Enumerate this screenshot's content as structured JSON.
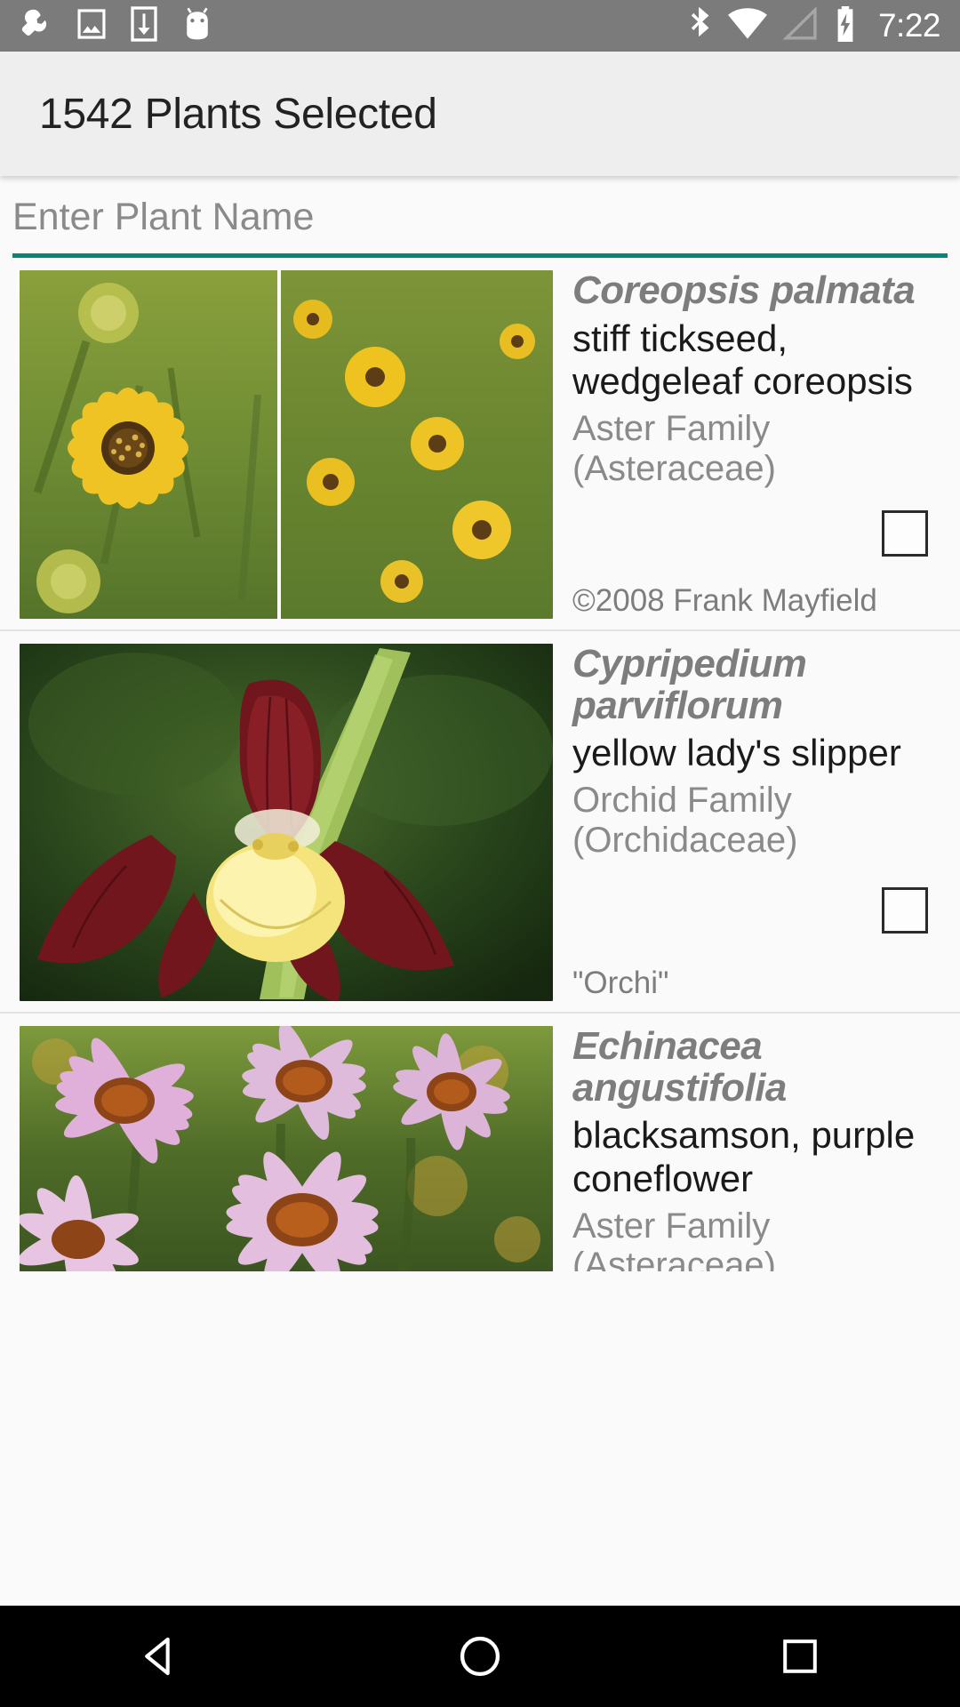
{
  "status_bar": {
    "background": "#7b7b7b",
    "left_icons": [
      {
        "name": "wrench-icon",
        "label": "wrench"
      },
      {
        "name": "image-icon",
        "label": "screenshot"
      },
      {
        "name": "download-icon",
        "label": "download"
      },
      {
        "name": "android-robot-icon",
        "label": "android"
      }
    ],
    "right_icons": [
      {
        "name": "bluetooth-icon",
        "label": "bluetooth"
      },
      {
        "name": "wifi-icon",
        "label": "wifi"
      },
      {
        "name": "cell-signal-icon",
        "label": "signal"
      },
      {
        "name": "battery-charging-icon",
        "label": "battery charging"
      }
    ],
    "clock": "7:22"
  },
  "toolbar": {
    "title": "1542 Plants Selected",
    "background": "#eeeeee"
  },
  "search": {
    "placeholder": "Enter Plant Name",
    "value": "",
    "underline_color": "#00897b"
  },
  "list": {
    "items": [
      {
        "scientific_name": "Coreopsis palmata",
        "common_names": "stiff tickseed, wedgeleaf coreopsis",
        "family": "Aster Family (Asteraceae)",
        "attribution": "©2008 Frank Mayfield",
        "checked": false,
        "thumb_name": "coreopsis-palmata-photo"
      },
      {
        "scientific_name": "Cypripedium parviflorum",
        "common_names": "yellow lady's slipper",
        "family": "Orchid Family (Orchidaceae)",
        "attribution": "\"Orchi\"",
        "checked": false,
        "thumb_name": "cypripedium-parviflorum-photo"
      },
      {
        "scientific_name": "Echinacea angustifolia",
        "common_names": "blacksamson, purple coneflower",
        "family": "Aster Family (Asteraceae)",
        "attribution": "",
        "checked": false,
        "thumb_name": "echinacea-angustifolia-photo"
      }
    ]
  },
  "nav_bar": {
    "background": "#000000",
    "buttons": [
      {
        "name": "back-button",
        "label": "Back"
      },
      {
        "name": "home-button",
        "label": "Home"
      },
      {
        "name": "recents-button",
        "label": "Recents"
      }
    ]
  }
}
